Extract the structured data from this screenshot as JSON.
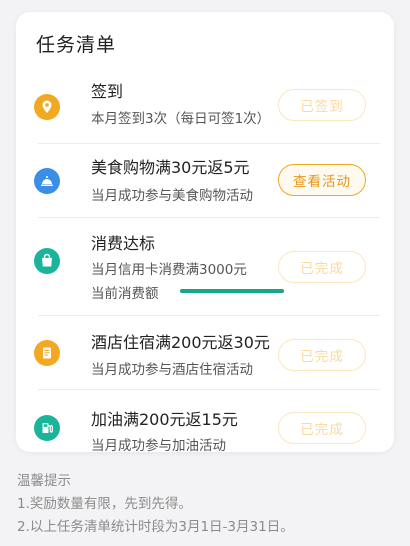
{
  "card": {
    "title": "任务清单"
  },
  "tasks": [
    {
      "title": "签到",
      "desc": "本月签到3次（每日可签1次）",
      "button": "已签到",
      "button_state": "disabled",
      "icon": "location-pin-icon",
      "icon_color": "#f2a821"
    },
    {
      "title": "美食购物满30元返5元",
      "desc": "当月成功参与美食购物活动",
      "button": "查看活动",
      "button_state": "active",
      "icon": "dish-cloche-icon",
      "icon_color": "#3a8ee6"
    },
    {
      "title": "消费达标",
      "desc": "当月信用卡消费满3000元",
      "desc2": "当前消费额",
      "progress": 1.0,
      "button": "已完成",
      "button_state": "disabled",
      "icon": "shopping-bag-icon",
      "icon_color": "#19b49a"
    },
    {
      "title": "酒店住宿满200元返30元",
      "desc": "当月成功参与酒店住宿活动",
      "button": "已完成",
      "button_state": "disabled",
      "icon": "hotel-document-icon",
      "icon_color": "#f2a821"
    },
    {
      "title": "加油满200元返15元",
      "desc": "当月成功参与加油活动",
      "button": "已完成",
      "button_state": "disabled",
      "icon": "fuel-pump-icon",
      "icon_color": "#19b49a"
    }
  ],
  "tips": {
    "heading": "温馨提示",
    "items": [
      "1.奖励数量有限，先到先得。",
      "2.以上任务清单统计时段为3月1日-3月31日。"
    ]
  },
  "colors": {
    "accent": "#e8961a",
    "progress": "#16a58d",
    "disabled_border": "#fbe7bf"
  }
}
